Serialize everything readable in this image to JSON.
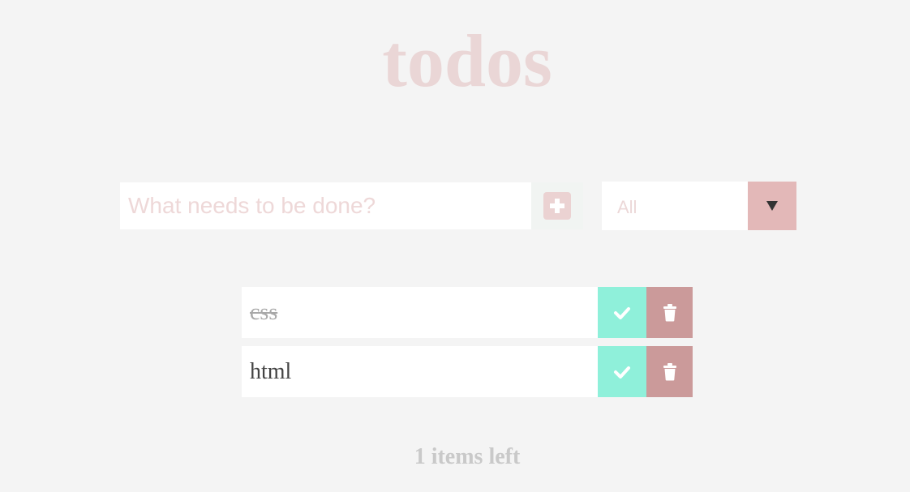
{
  "header": {
    "title": "todos"
  },
  "new_todo": {
    "placeholder": "What needs to be done?",
    "value": "",
    "add_icon": "plus-icon"
  },
  "filter": {
    "selected": "All",
    "arrow_icon": "triangle-down-icon"
  },
  "todos": [
    {
      "text": "css",
      "completed": true
    },
    {
      "text": "html",
      "completed": false
    }
  ],
  "footer": {
    "items_left": "1 items left"
  },
  "colors": {
    "background": "#f4f4f4",
    "title": "#ead6d6",
    "check_button": "#8ff0da",
    "delete_button": "#cb9a9a",
    "filter_arrow_bg": "#e3b8b8",
    "footer_text": "#c9c9c9"
  }
}
